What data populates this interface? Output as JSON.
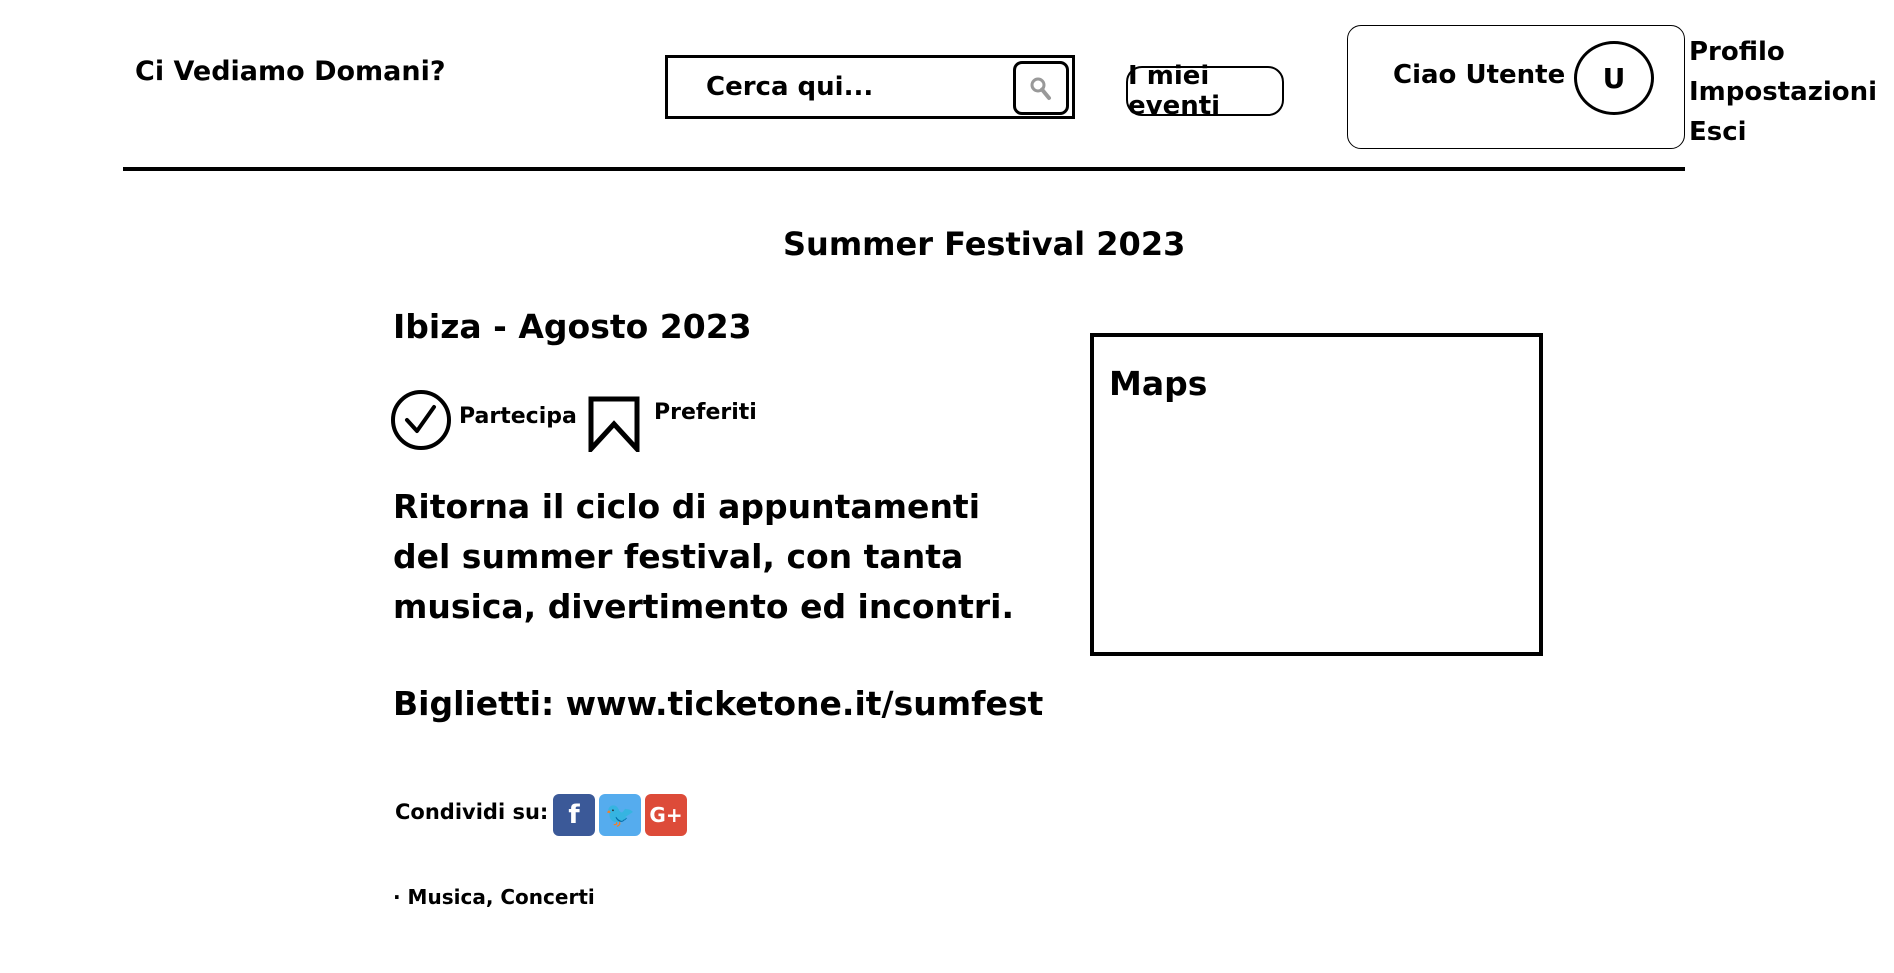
{
  "header": {
    "brand": "Ci Vediamo Domani?",
    "search": {
      "placeholder": "Cerca qui...",
      "button_icon": "search-icon"
    },
    "my_events_label": "I miei eventi",
    "user": {
      "greeting": "Ciao Utente",
      "avatar_letter": "U"
    },
    "user_menu": [
      "Profilo",
      "Impostazioni",
      "Esci"
    ]
  },
  "event": {
    "title": "Summer Festival 2023",
    "location_date": "Ibiza - Agosto 2023",
    "actions": {
      "participate_label": "Partecipa",
      "participate_icon": "check-circle-icon",
      "favorites_label": "Preferiti",
      "favorites_icon": "bookmark-icon"
    },
    "description_lines": [
      "Ritorna il ciclo di appuntamenti",
      "del summer festival, con tanta",
      "musica, divertimento ed incontri."
    ],
    "tickets": "Biglietti: www.ticketone.it/sumfest",
    "share": {
      "label": "Condividi su:",
      "networks": [
        {
          "name": "facebook",
          "glyph": "f",
          "color": "#3b5998",
          "icon": "facebook-icon"
        },
        {
          "name": "twitter",
          "glyph": "🐦",
          "color": "#55acee",
          "icon": "twitter-icon"
        },
        {
          "name": "google-plus",
          "glyph": "G+",
          "color": "#dd4b39",
          "icon": "google-plus-icon"
        }
      ]
    },
    "categories": "· Musica, Concerti",
    "map_label": "Maps"
  }
}
